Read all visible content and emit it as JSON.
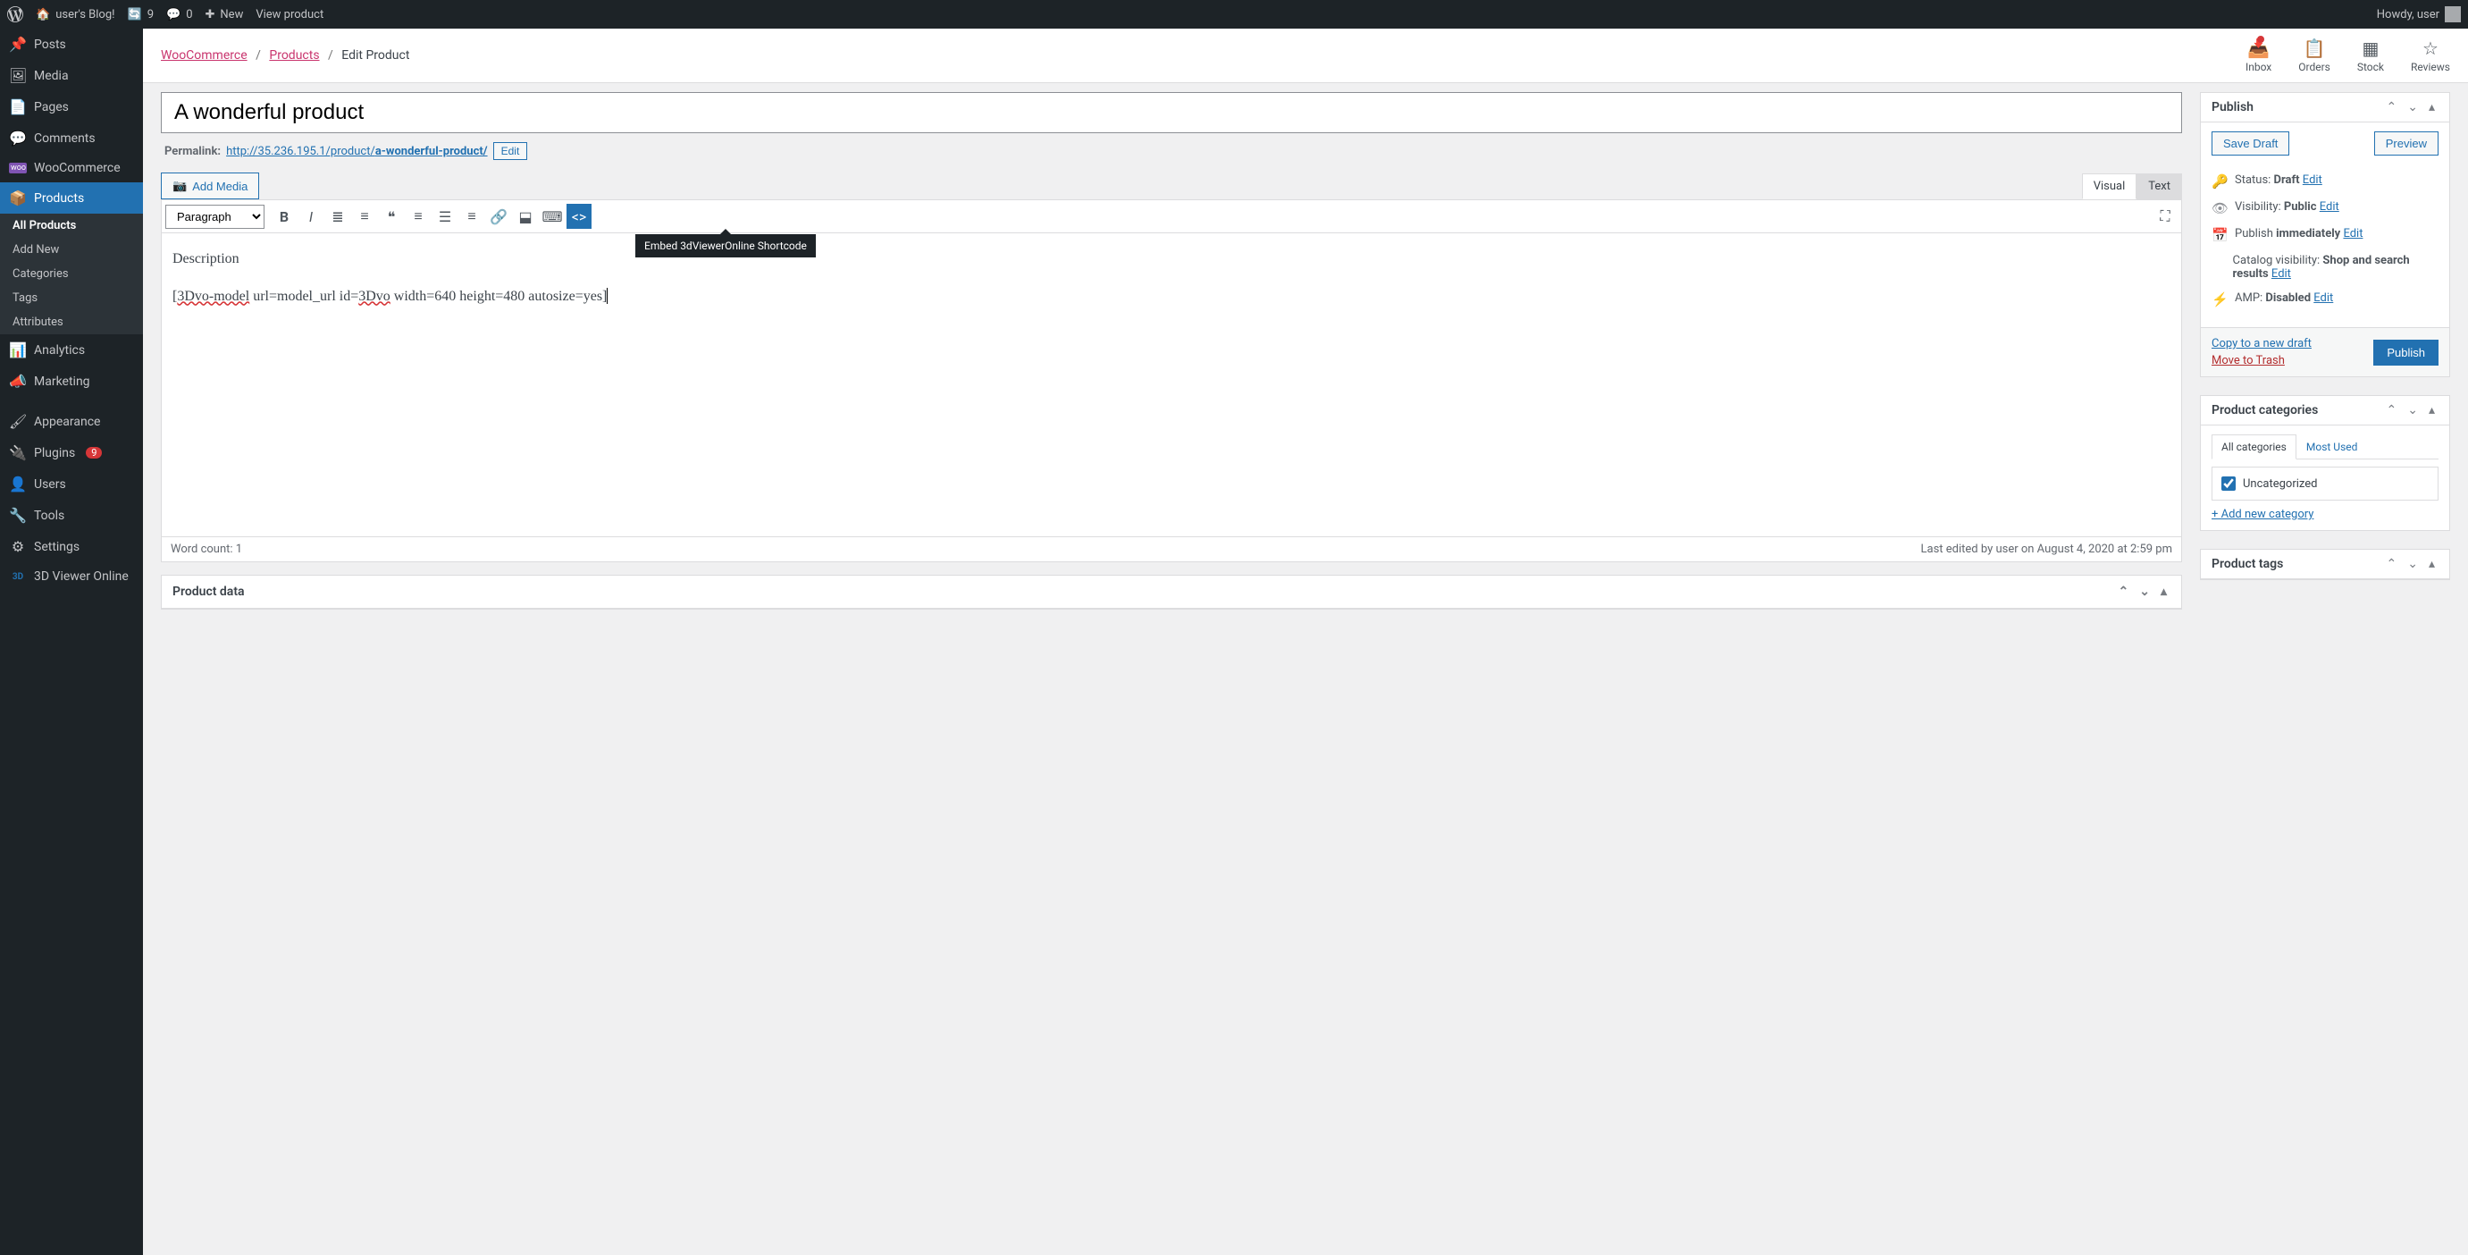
{
  "adminbar": {
    "site": "user's Blog!",
    "updates": "9",
    "comments": "0",
    "new": "New",
    "view": "View product",
    "howdy": "Howdy, user"
  },
  "sidebar": {
    "posts": "Posts",
    "media": "Media",
    "pages": "Pages",
    "comments": "Comments",
    "woocommerce": "WooCommerce",
    "products": "Products",
    "sub_all": "All Products",
    "sub_add": "Add New",
    "sub_cat": "Categories",
    "sub_tags": "Tags",
    "sub_attr": "Attributes",
    "analytics": "Analytics",
    "marketing": "Marketing",
    "appearance": "Appearance",
    "plugins": "Plugins",
    "plugins_badge": "9",
    "users": "Users",
    "tools": "Tools",
    "settings": "Settings",
    "viewer": "3D Viewer Online"
  },
  "breadcrumb": {
    "woo": "WooCommerce",
    "products": "Products",
    "current": "Edit Product"
  },
  "activity": {
    "inbox": "Inbox",
    "orders": "Orders",
    "stock": "Stock",
    "reviews": "Reviews"
  },
  "editor": {
    "title": "A wonderful product",
    "permalink_label": "Permalink:",
    "permalink_base": "http://35.236.195.1/product/",
    "permalink_slug": "a-wonderful-product/",
    "edit": "Edit",
    "add_media": "Add Media",
    "tab_visual": "Visual",
    "tab_text": "Text",
    "paragraph": "Paragraph",
    "tooltip": "Embed 3dViewerOnline Shortcode",
    "body_p1": "Description",
    "body_p2_err1": "3Dvo-model",
    "body_p2_mid": " url=model_url id=",
    "body_p2_err2": "3Dvo",
    "body_p2_end": " width=640 height=480 autosize=yes]",
    "wordcount": "Word count: 1",
    "lastedit": "Last edited by user on August 4, 2020 at 2:59 pm",
    "product_data": "Product data"
  },
  "publish": {
    "title": "Publish",
    "save_draft": "Save Draft",
    "preview": "Preview",
    "status_label": "Status: ",
    "status_value": "Draft",
    "visibility_label": "Visibility: ",
    "visibility_value": "Public",
    "publish_label": "Publish ",
    "publish_value": "immediately",
    "catalog_label": "Catalog visibility: ",
    "catalog_value": "Shop and search results",
    "amp_label": "AMP: ",
    "amp_value": "Disabled",
    "edit": "Edit",
    "copy": "Copy to a new draft",
    "trash": "Move to Trash",
    "publish_btn": "Publish"
  },
  "categories": {
    "title": "Product categories",
    "tab_all": "All categories",
    "tab_most": "Most Used",
    "uncategorized": "Uncategorized",
    "add": "+ Add new category"
  },
  "tags": {
    "title": "Product tags"
  }
}
